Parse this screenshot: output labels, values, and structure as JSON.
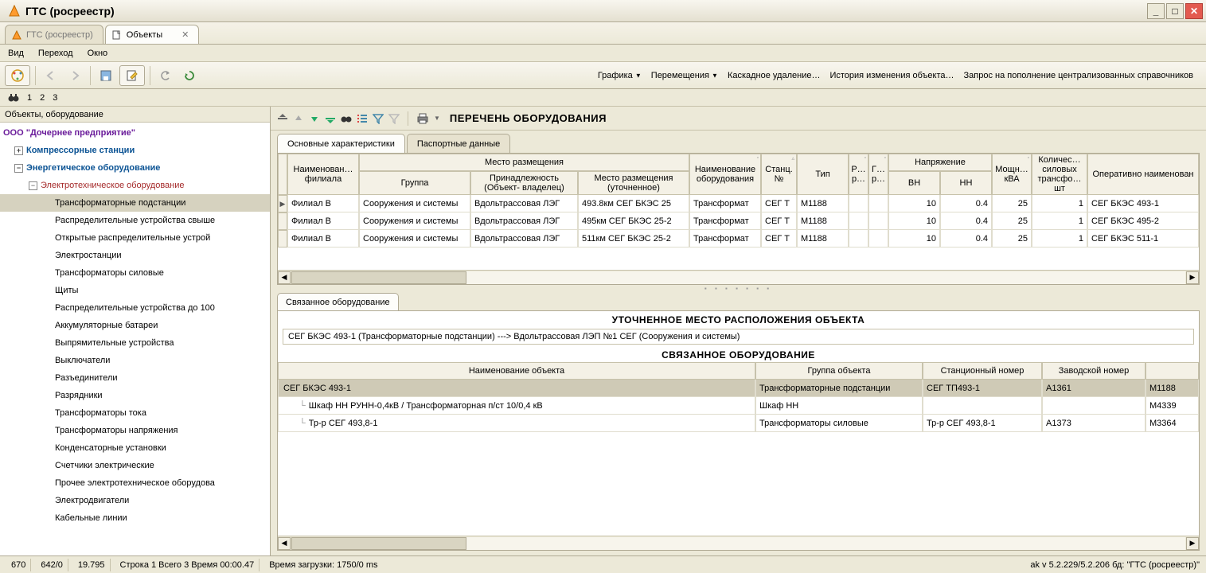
{
  "window": {
    "title": "ГТС (росреестр)"
  },
  "tabs": [
    {
      "label": "ГТС (росреестр)",
      "active": false
    },
    {
      "label": "Объекты",
      "active": true
    }
  ],
  "menubar": [
    "Вид",
    "Переход",
    "Окно"
  ],
  "quickbar": [
    "1",
    "2",
    "3"
  ],
  "rightMenu": [
    {
      "label": "Графика",
      "dropdown": true
    },
    {
      "label": "Перемещения",
      "dropdown": true
    },
    {
      "label": "Каскадное удаление…",
      "dropdown": false
    },
    {
      "label": "История изменения объекта…",
      "dropdown": false
    },
    {
      "label": "Запрос на пополнение централизованных справочников",
      "dropdown": false
    }
  ],
  "leftPane": {
    "header": "Объекты, оборудование",
    "org": "ООО \"Дочернее предприятие\"",
    "nodes": [
      {
        "label": "Компрессорные станции",
        "level": 1,
        "exp": "+",
        "cls": "cat"
      },
      {
        "label": "Энергетическое оборудование",
        "level": 1,
        "exp": "-",
        "cls": "cat"
      },
      {
        "label": "Электротехническое оборудование",
        "level": 2,
        "exp": "-",
        "cls": "sub"
      },
      {
        "label": "Трансформаторные подстанции",
        "level": 3,
        "exp": "",
        "cls": "leaf",
        "selected": true
      },
      {
        "label": "Распределительные устройства свыше",
        "level": 3,
        "exp": "",
        "cls": "leaf"
      },
      {
        "label": "Открытые распределительные устрой",
        "level": 3,
        "exp": "",
        "cls": "leaf"
      },
      {
        "label": "Электростанции",
        "level": 3,
        "exp": "",
        "cls": "leaf"
      },
      {
        "label": "Трансформаторы силовые",
        "level": 3,
        "exp": "",
        "cls": "leaf"
      },
      {
        "label": "Щиты",
        "level": 3,
        "exp": "",
        "cls": "leaf"
      },
      {
        "label": "Распределительные устройства до 100",
        "level": 3,
        "exp": "",
        "cls": "leaf"
      },
      {
        "label": "Аккумуляторные батареи",
        "level": 3,
        "exp": "",
        "cls": "leaf"
      },
      {
        "label": "Выпрямительные устройства",
        "level": 3,
        "exp": "",
        "cls": "leaf"
      },
      {
        "label": "Выключатели",
        "level": 3,
        "exp": "",
        "cls": "leaf"
      },
      {
        "label": "Разъединители",
        "level": 3,
        "exp": "",
        "cls": "leaf"
      },
      {
        "label": "Разрядники",
        "level": 3,
        "exp": "",
        "cls": "leaf"
      },
      {
        "label": "Трансформаторы тока",
        "level": 3,
        "exp": "",
        "cls": "leaf"
      },
      {
        "label": "Трансформаторы напряжения",
        "level": 3,
        "exp": "",
        "cls": "leaf"
      },
      {
        "label": "Конденсаторные установки",
        "level": 3,
        "exp": "",
        "cls": "leaf"
      },
      {
        "label": "Счетчики электрические",
        "level": 3,
        "exp": "",
        "cls": "leaf"
      },
      {
        "label": "Прочее электротехническое оборудова",
        "level": 3,
        "exp": "",
        "cls": "leaf"
      },
      {
        "label": "Электродвигатели",
        "level": 3,
        "exp": "",
        "cls": "leaf"
      },
      {
        "label": "Кабельные линии",
        "level": 3,
        "exp": "",
        "cls": "leaf"
      }
    ]
  },
  "rightPane": {
    "title": "ПЕРЕЧЕНЬ ОБОРУДОВАНИЯ",
    "subtabs": [
      "Основные характеристики",
      "Паспортные данные"
    ],
    "columns": {
      "c1": "Наименован… филиала",
      "c2grp": "Место размещения",
      "c2a": "Группа",
      "c2b": "Принадлежность (Объект- владелец)",
      "c2c": "Место размещения (уточненное)",
      "c3": "Наименование оборудования",
      "c4": "Станц. №",
      "c5": "Тип",
      "c6": "Р… р…",
      "c7": "Г… р…",
      "c8grp": "Напряжение",
      "c8a": "ВН",
      "c8b": "НН",
      "c9": "Мощн… кВА",
      "c10": "Количес… силовых трансфо… шт",
      "c11": "Оперативно наименован"
    },
    "rows": [
      {
        "filial": "Филиал В",
        "group": "Сооружения и системы",
        "owner": "Вдольтрассовая ЛЭГ",
        "loc": "493.8км СЕГ БКЭС 25",
        "equip": "Трансформат",
        "stnum": "СЕГ Т",
        "type": "М1188",
        "r1": "",
        "r2": "",
        "vn": "10",
        "nn": "0.4",
        "power": "25",
        "cnt": "1",
        "oper": "СЕГ БКЭС 493-1",
        "current": true
      },
      {
        "filial": "Филиал В",
        "group": "Сооружения и системы",
        "owner": "Вдольтрассовая ЛЭГ",
        "loc": "495км СЕГ БКЭС 25-2",
        "equip": "Трансформат",
        "stnum": "СЕГ Т",
        "type": "М1188",
        "r1": "",
        "r2": "",
        "vn": "10",
        "nn": "0.4",
        "power": "25",
        "cnt": "1",
        "oper": "СЕГ БКЭС 495-2"
      },
      {
        "filial": "Филиал В",
        "group": "Сооружения и системы",
        "owner": "Вдольтрассовая ЛЭГ",
        "loc": "511км СЕГ БКЭС 25-2",
        "equip": "Трансформат",
        "stnum": "СЕГ Т",
        "type": "М1188",
        "r1": "",
        "r2": "",
        "vn": "10",
        "nn": "0.4",
        "power": "25",
        "cnt": "1",
        "oper": "СЕГ БКЭС 511-1"
      }
    ]
  },
  "linked": {
    "tab": "Связанное оборудование",
    "locTitle": "УТОЧНЕННОЕ МЕСТО РАСПОЛОЖЕНИЯ ОБЪЕКТА",
    "locPath": "СЕГ БКЭС 493-1 (Трансформаторные подстанции)  --->   Вдольтрассовая ЛЭП №1 СЕГ (Сооружения и системы)",
    "secTitle": "СВЯЗАННОЕ ОБОРУДОВАНИЕ",
    "columns": {
      "c1": "Наименование объекта",
      "c2": "Группа объекта",
      "c3": "Станционный номер",
      "c4": "Заводской номер",
      "c5": ""
    },
    "rows": [
      {
        "name": "СЕГ БКЭС 493-1",
        "group": "Трансформаторные подстанции",
        "stnum": "СЕГ ТП493-1",
        "serial": "А1361",
        "extra": "М1188",
        "depth": 0,
        "selected": true
      },
      {
        "name": "Шкаф НН РУНН-0,4кВ / Трансформаторная п/ст 10/0,4 кВ",
        "group": "Шкаф НН",
        "stnum": "",
        "serial": "",
        "extra": "М4339",
        "depth": 1
      },
      {
        "name": "Тр-р СЕГ 493,8-1",
        "group": "Трансформаторы силовые",
        "stnum": "Тр-р СЕГ 493,8-1",
        "serial": "А1373",
        "extra": "М3364",
        "depth": 1
      }
    ]
  },
  "status": {
    "s1": "670",
    "s2": "642/0",
    "s3": "19.795",
    "s4": "Строка 1 Всего 3 Время 00:00.47",
    "s5": "Время загрузки: 1750/0 ms",
    "right": "ak  v 5.2.229/5.2.206  бд: \"ГТС (росреестр)\""
  }
}
